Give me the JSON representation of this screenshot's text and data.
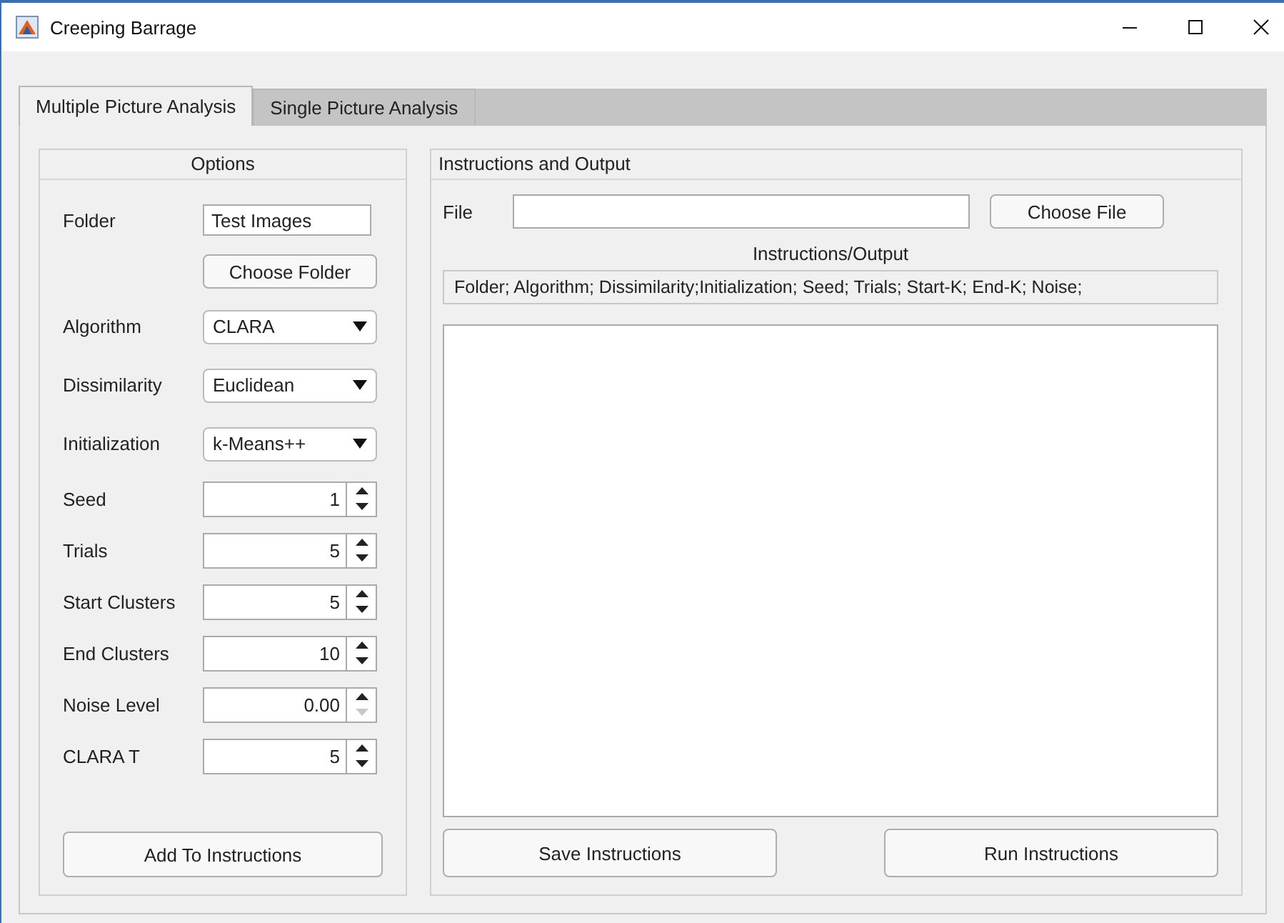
{
  "window": {
    "title": "Creeping Barrage"
  },
  "tabs": [
    {
      "label": "Multiple Picture Analysis",
      "selected": true
    },
    {
      "label": "Single Picture Analysis",
      "selected": false
    }
  ],
  "options": {
    "title": "Options",
    "rows": [
      {
        "kind": "text",
        "label": "Folder",
        "value": "Test Images"
      },
      {
        "kind": "button",
        "label": "Choose Folder"
      },
      {
        "kind": "dropdown",
        "label": "Algorithm",
        "value": "CLARA"
      },
      {
        "kind": "dropdown",
        "label": "Dissimilarity",
        "value": "Euclidean"
      },
      {
        "kind": "dropdown",
        "label": "Initialization",
        "value": "k-Means++"
      },
      {
        "kind": "spinner",
        "label": "Seed",
        "value": "1",
        "down_disabled": false
      },
      {
        "kind": "spinner",
        "label": "Trials",
        "value": "5",
        "down_disabled": false
      },
      {
        "kind": "spinner",
        "label": "Start Clusters",
        "value": "5",
        "down_disabled": false
      },
      {
        "kind": "spinner",
        "label": "End Clusters",
        "value": "10",
        "down_disabled": false
      },
      {
        "kind": "spinner",
        "label": "Noise Level",
        "value": "0.00",
        "down_disabled": true
      },
      {
        "kind": "spinner",
        "label": "CLARA T",
        "value": "5",
        "down_disabled": false
      }
    ],
    "button": "Add To Instructions"
  },
  "output": {
    "title": "Instructions and Output",
    "file_label": "File",
    "file_button": "Choose File",
    "heading": "Instructions/Output",
    "header_line": "Folder; Algorithm; Dissimilarity;Initialization; Seed; Trials; Start-K; End-K; Noise;",
    "buttons": [
      "Save Instructions",
      "Run Instructions"
    ]
  }
}
